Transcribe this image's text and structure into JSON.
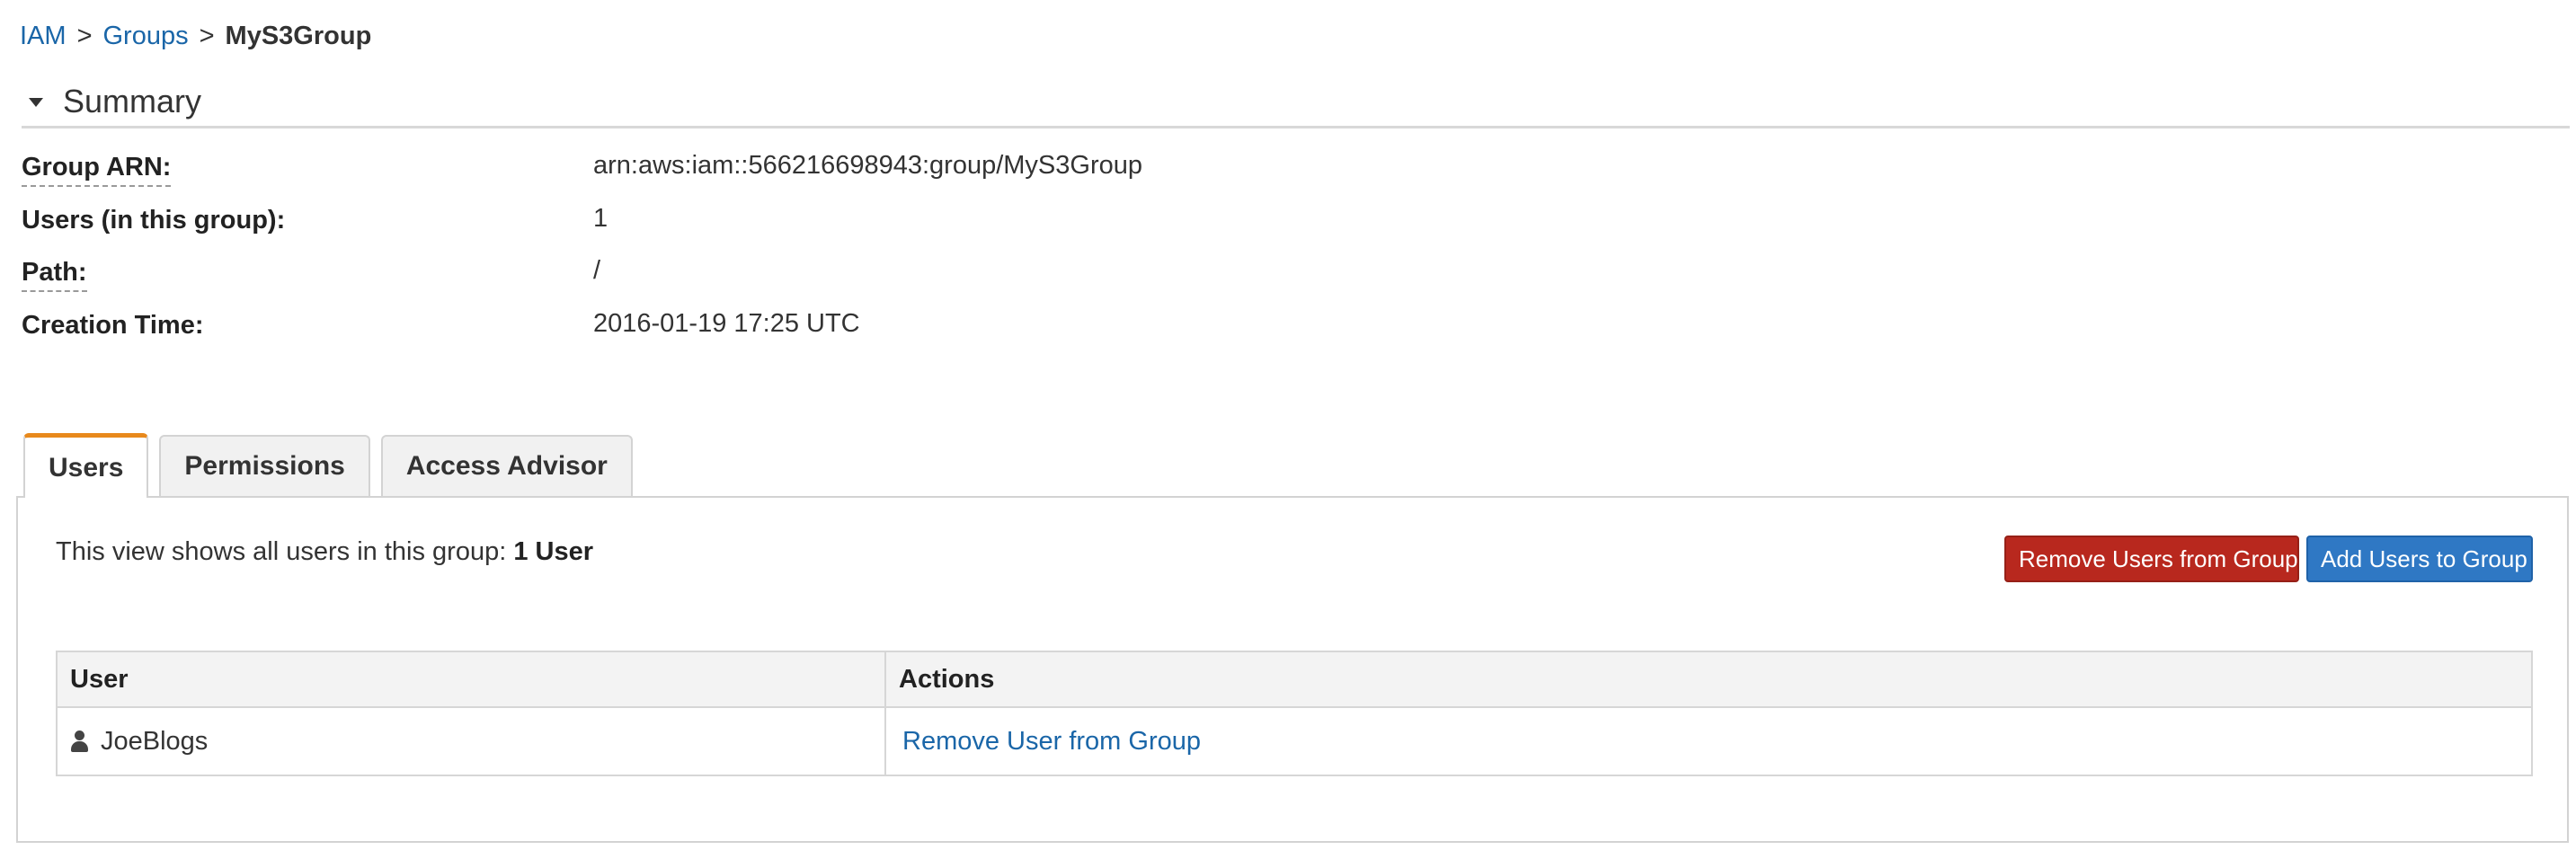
{
  "breadcrumb": {
    "items": [
      "IAM",
      "Groups"
    ],
    "separator": ">",
    "current": "MyS3Group"
  },
  "summary": {
    "title": "Summary",
    "rows": [
      {
        "label": "Group ARN:",
        "value": "arn:aws:iam::566216698943:group/MyS3Group"
      },
      {
        "label": "Users (in this group):",
        "value": "1"
      },
      {
        "label": "Path:",
        "value": "/"
      },
      {
        "label": "Creation Time:",
        "value": "2016-01-19 17:25 UTC"
      }
    ]
  },
  "tabs": [
    {
      "label": "Users",
      "active": true
    },
    {
      "label": "Permissions",
      "active": false
    },
    {
      "label": "Access Advisor",
      "active": false
    }
  ],
  "users_panel": {
    "intro_text": "This view shows all users in this group:",
    "intro_count": "1 User",
    "remove_button": "Remove Users from Group",
    "add_button": "Add Users to Group",
    "table": {
      "headers": [
        "User",
        "Actions"
      ],
      "rows": [
        {
          "user": "JoeBlogs",
          "action": "Remove User from Group"
        }
      ]
    }
  },
  "colors": {
    "link": "#1a66a8",
    "active_tab_accent": "#e8891c",
    "danger_button": "#b8281e",
    "primary_button": "#2f78c4"
  },
  "icons": {
    "summary_toggle": "caret-down-icon",
    "user_row": "user-icon"
  }
}
